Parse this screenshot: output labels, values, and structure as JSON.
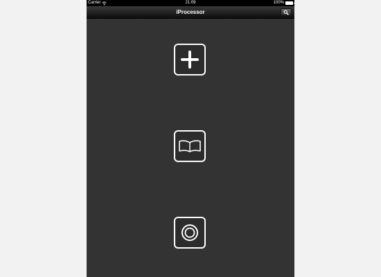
{
  "status_bar": {
    "carrier": "Carrier",
    "time": "21:09",
    "battery": "100%",
    "wifi_icon": "wifi-icon",
    "battery_icon": "battery-icon"
  },
  "nav_bar": {
    "title": "iProcessor",
    "search_icon": "search-icon"
  },
  "main_buttons": [
    {
      "name": "add-button",
      "icon": "plus-icon"
    },
    {
      "name": "library-button",
      "icon": "open-book-icon"
    },
    {
      "name": "record-button",
      "icon": "target-circle-icon"
    }
  ],
  "colors": {
    "background": "#333333",
    "status_bar": "#000000",
    "icon_stroke": "#ffffff"
  }
}
